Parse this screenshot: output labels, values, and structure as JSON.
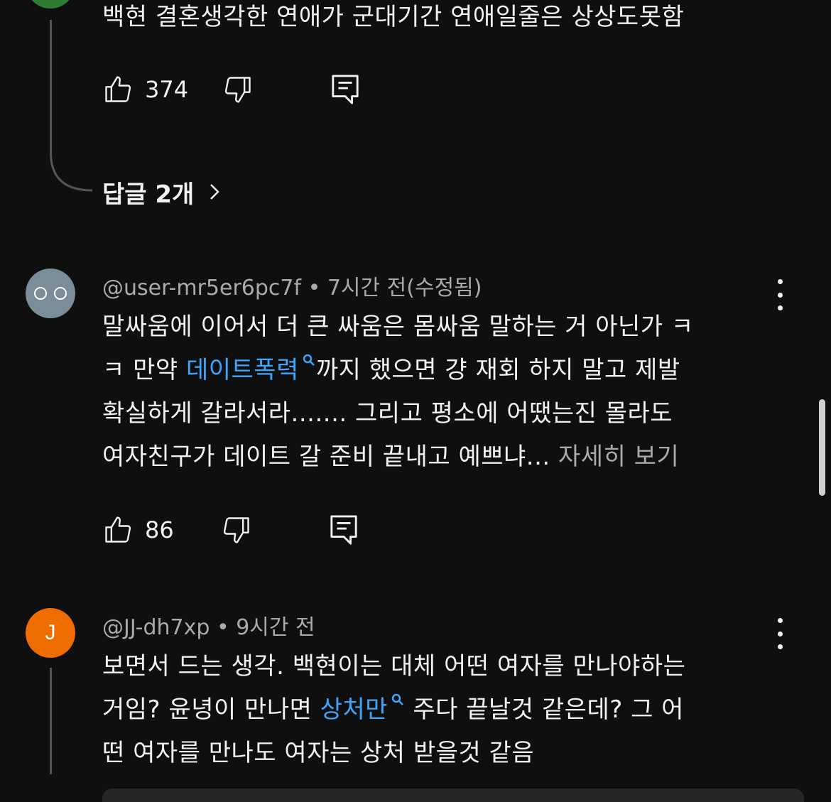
{
  "top_comment": {
    "text": "백현 결혼생각한 연애가 군대기간 연애일줄은 상상도못함",
    "likes": "374",
    "replies_label": "답글 2개"
  },
  "comments": [
    {
      "handle": "@user-mr5er6pc7f",
      "time": "7시간 전(수정됨)",
      "avatar_initial": "",
      "text_line1": "말싸움에 이어서 더 큰 싸움은 몸싸움 말하는 거 아닌가 ㅋ",
      "text_line2_a": "ㅋ 만약 ",
      "text_line2_link": "데이트폭력",
      "text_line2_b": "까지 했으면 걍 재회 하지 말고 제발",
      "text_line3": "확실하게 갈라서라....... 그리고 평소에 어땠는진 몰라도",
      "text_line4": "여자친구가 데이트 갈 준비 끝내고 예쁘냐... ",
      "more_label": "자세히 보기",
      "likes": "86"
    },
    {
      "handle": "@JJ-dh7xp",
      "time": "9시간 전",
      "avatar_initial": "J",
      "text_line1": "보면서 드는 생각. 백현이는 대체 어떤 여자를 만나야하는",
      "text_line2_a": "거임? 윤녕이 만나면 ",
      "text_line2_link": "상처만",
      "text_line2_b": " 주다 끝날것 같은데? 그 어",
      "text_line3": "떤 여자를 만나도 여자는 상처 받을것 같음"
    }
  ],
  "colors": {
    "background": "#0f0f0f",
    "link": "#3ea6ff",
    "avatar_gray": "#7b8d98",
    "avatar_orange": "#ef6c00",
    "avatar_green": "#2e7d32"
  },
  "icons": [
    "like-icon",
    "dislike-icon",
    "reply-icon",
    "chevron-right-icon",
    "kebab-menu-icon",
    "search-icon"
  ]
}
